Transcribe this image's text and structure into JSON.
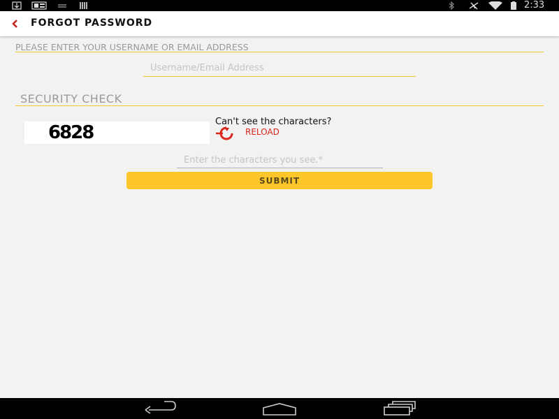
{
  "status_bar": {
    "time": "2:33",
    "left_icons": [
      "download-icon",
      "news-icon",
      "notification-icon",
      "store-icon"
    ],
    "right_icons": [
      "bluetooth-icon",
      "airplane-mode-icon",
      "wifi-icon",
      "battery-icon"
    ]
  },
  "toolbar": {
    "back_icon": "chevron-left-icon",
    "title": "FORGOT PASSWORD"
  },
  "identity_section": {
    "label": "PLEASE ENTER YOUR USERNAME OR EMAIL ADDRESS",
    "input_placeholder": "Username/Email Address",
    "input_value": ""
  },
  "security_section": {
    "label": "SECURITY CHECK",
    "captcha_text": "6828",
    "cant_see_text": "Can't see the characters?",
    "reload_label": "RELOAD",
    "input_placeholder": "Enter the characters you see.*",
    "input_value": ""
  },
  "submit_label": "SUBMIT",
  "nav_bar": {
    "buttons": [
      "back-icon",
      "home-icon",
      "recents-icon"
    ]
  },
  "colors": {
    "accent_line": "#f2c62d",
    "submit_bg": "#fdc62a",
    "reload_red": "#d9261c",
    "background": "#f2f2f2"
  }
}
